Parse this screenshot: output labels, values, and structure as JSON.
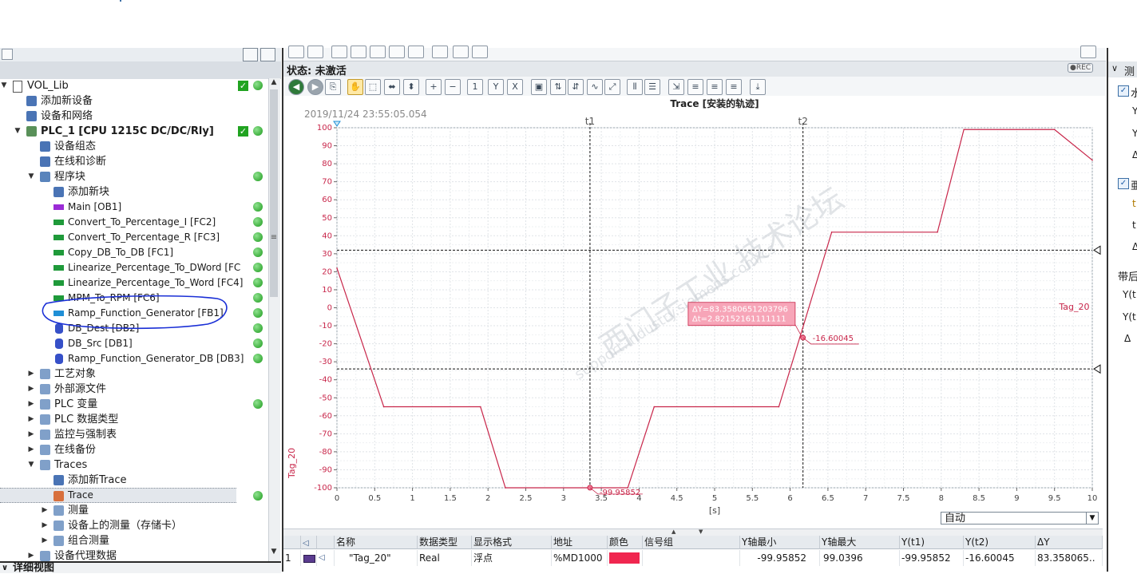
{
  "tree": {
    "items": [
      {
        "label": "VOL_Lib",
        "indent": 0,
        "arrow": "▼",
        "icon": "project-icon",
        "check": true,
        "dot": true
      },
      {
        "label": "添加新设备",
        "indent": 1,
        "arrow": "",
        "icon": "add-device-icon"
      },
      {
        "label": "设备和网络",
        "indent": 1,
        "arrow": "",
        "icon": "network-icon"
      },
      {
        "label": "PLC_1 [CPU 1215C DC/DC/Rly]",
        "indent": 1,
        "arrow": "▼",
        "icon": "plc-icon",
        "check": true,
        "dot": true,
        "bold": true
      },
      {
        "label": "设备组态",
        "indent": 2,
        "arrow": "",
        "icon": "device-config-icon"
      },
      {
        "label": "在线和诊断",
        "indent": 2,
        "arrow": "",
        "icon": "diagnostics-icon"
      },
      {
        "label": "程序块",
        "indent": 2,
        "arrow": "▼",
        "icon": "program-blocks-icon",
        "dot": true
      },
      {
        "label": "添加新块",
        "indent": 3,
        "arrow": "",
        "icon": "add-block-icon"
      },
      {
        "label": "Main [OB1]",
        "indent": 3,
        "arrow": "",
        "icon": "ob-block-icon",
        "dot": true
      },
      {
        "label": "Convert_To_Percentage_I [FC2]",
        "indent": 3,
        "arrow": "",
        "icon": "fc-block-icon",
        "dot": true
      },
      {
        "label": "Convert_To_Percentage_R [FC3]",
        "indent": 3,
        "arrow": "",
        "icon": "fc-block-icon",
        "dot": true
      },
      {
        "label": "Copy_DB_To_DB [FC1]",
        "indent": 3,
        "arrow": "",
        "icon": "fc-block-icon",
        "dot": true
      },
      {
        "label": "Linearize_Percentage_To_DWord [FC",
        "indent": 3,
        "arrow": "",
        "icon": "fc-block-icon",
        "dot": true
      },
      {
        "label": "Linearize_Percentage_To_Word [FC4]",
        "indent": 3,
        "arrow": "",
        "icon": "fc-block-icon",
        "dot": true
      },
      {
        "label": "MPM_To_RPM [FC6]",
        "indent": 3,
        "arrow": "",
        "icon": "fc-block-icon",
        "dot": true
      },
      {
        "label": "Ramp_Function_Generator [FB1]",
        "indent": 3,
        "arrow": "",
        "icon": "fb-block-icon",
        "dot": true
      },
      {
        "label": "DB_Dest [DB2]",
        "indent": 3,
        "arrow": "",
        "icon": "db-block-icon",
        "dot": true
      },
      {
        "label": "DB_Src [DB1]",
        "indent": 3,
        "arrow": "",
        "icon": "db-block-icon",
        "dot": true
      },
      {
        "label": "Ramp_Function_Generator_DB [DB3]",
        "indent": 3,
        "arrow": "",
        "icon": "db-block-icon",
        "dot": true
      },
      {
        "label": "工艺对象",
        "indent": 2,
        "arrow": "▶",
        "icon": "folder-icon"
      },
      {
        "label": "外部源文件",
        "indent": 2,
        "arrow": "▶",
        "icon": "folder-icon"
      },
      {
        "label": "PLC 变量",
        "indent": 2,
        "arrow": "▶",
        "icon": "folder-icon",
        "dot": true
      },
      {
        "label": "PLC 数据类型",
        "indent": 2,
        "arrow": "▶",
        "icon": "folder-icon"
      },
      {
        "label": "监控与强制表",
        "indent": 2,
        "arrow": "▶",
        "icon": "folder-icon"
      },
      {
        "label": "在线备份",
        "indent": 2,
        "arrow": "▶",
        "icon": "folder-icon"
      },
      {
        "label": "Traces",
        "indent": 2,
        "arrow": "▼",
        "icon": "folder-icon"
      },
      {
        "label": "添加新Trace",
        "indent": 3,
        "arrow": "",
        "icon": "add-trace-icon"
      },
      {
        "label": "Trace",
        "indent": 3,
        "arrow": "",
        "icon": "trace-icon",
        "dot": true,
        "selected": true
      },
      {
        "label": "测量",
        "indent": 3,
        "arrow": "▶",
        "icon": "folder-icon"
      },
      {
        "label": "设备上的测量（存储卡）",
        "indent": 3,
        "arrow": "▶",
        "icon": "folder-icon"
      },
      {
        "label": "组合测量",
        "indent": 3,
        "arrow": "▶",
        "icon": "folder-icon"
      },
      {
        "label": "设备代理数据",
        "indent": 2,
        "arrow": "▶",
        "icon": "folder-icon"
      }
    ],
    "detail_view": "详细视图"
  },
  "editor": {
    "status_label": "状态: 未激活",
    "rec_badge": "●REC",
    "chart_title": "Trace [安装的轨迹]",
    "timestamp": "2019/11/24 23:55:05.054",
    "watermark": [
      "西门子工业 技术论坛",
      "support.industry.siemens.com/cs"
    ],
    "cursor_box": {
      "dy": "ΔY=83.3580651203796",
      "dt": "Δt=2.82152161111111"
    },
    "cursor_value_t2": "-16.60045",
    "cursor_value_t1": "-99.95852",
    "t1_label": "t1",
    "t2_label": "t2",
    "series_label": "Tag_20",
    "x_unit": "[s]",
    "zoom_select": "自动"
  },
  "chart_data": {
    "type": "line",
    "title": "Trace [安装的轨迹]",
    "xlabel": "[s]",
    "ylabel": "Tag_20",
    "xlim": [
      0,
      10
    ],
    "ylim": [
      -100,
      100
    ],
    "x_ticks": [
      "0",
      "0.5",
      "1",
      "1.5",
      "2",
      "2.5",
      "3",
      "3.5",
      "4",
      "4.5",
      "5",
      "5.5",
      "6",
      "6.5",
      "7",
      "7.5",
      "8",
      "8.5",
      "9",
      "9.5",
      "10"
    ],
    "y_ticks": [
      "100",
      "90",
      "80",
      "70",
      "60",
      "50",
      "40",
      "30",
      "20",
      "10",
      "0",
      "-10",
      "-20",
      "-30",
      "-40",
      "-50",
      "-60",
      "-70",
      "-80",
      "-90",
      "-100"
    ],
    "series": [
      {
        "name": "Tag_20",
        "color": "#c8264a",
        "x": [
          0.0,
          0.62,
          1.9,
          2.23,
          3.85,
          4.2,
          5.85,
          6.55,
          7.95,
          8.3,
          9.5,
          10.0
        ],
        "y": [
          22,
          -55,
          -55,
          -100,
          -100,
          -55,
          -55,
          42,
          42,
          99,
          99,
          82
        ]
      }
    ],
    "cursors": {
      "t1": 3.35,
      "t2": 6.17,
      "y_upper": 32,
      "y_lower": -34
    },
    "grid": true
  },
  "table": {
    "headers": [
      "",
      "",
      "",
      "名称",
      "数据类型",
      "显示格式",
      "地址",
      "颜色",
      "信号组",
      "Y轴最小",
      "Y轴最大",
      "Y(t1)",
      "Y(t2)",
      "ΔY"
    ],
    "row": {
      "index": "1",
      "name": "\"Tag_20\"",
      "type": "Real",
      "format": "浮点",
      "address": "%MD1000",
      "color": "#f0264f",
      "group": "",
      "ymin": "-99.95852",
      "ymax": "99.0396",
      "yt1": "-99.95852",
      "yt2": "-16.60045",
      "dy": "83.358065.."
    }
  },
  "right_panel": {
    "items": [
      "测",
      "水",
      "Y",
      "Y",
      "Δ",
      "亜",
      "t",
      "t",
      "Δ",
      "带后",
      "Y(t",
      "Y(t",
      "Δ"
    ]
  }
}
